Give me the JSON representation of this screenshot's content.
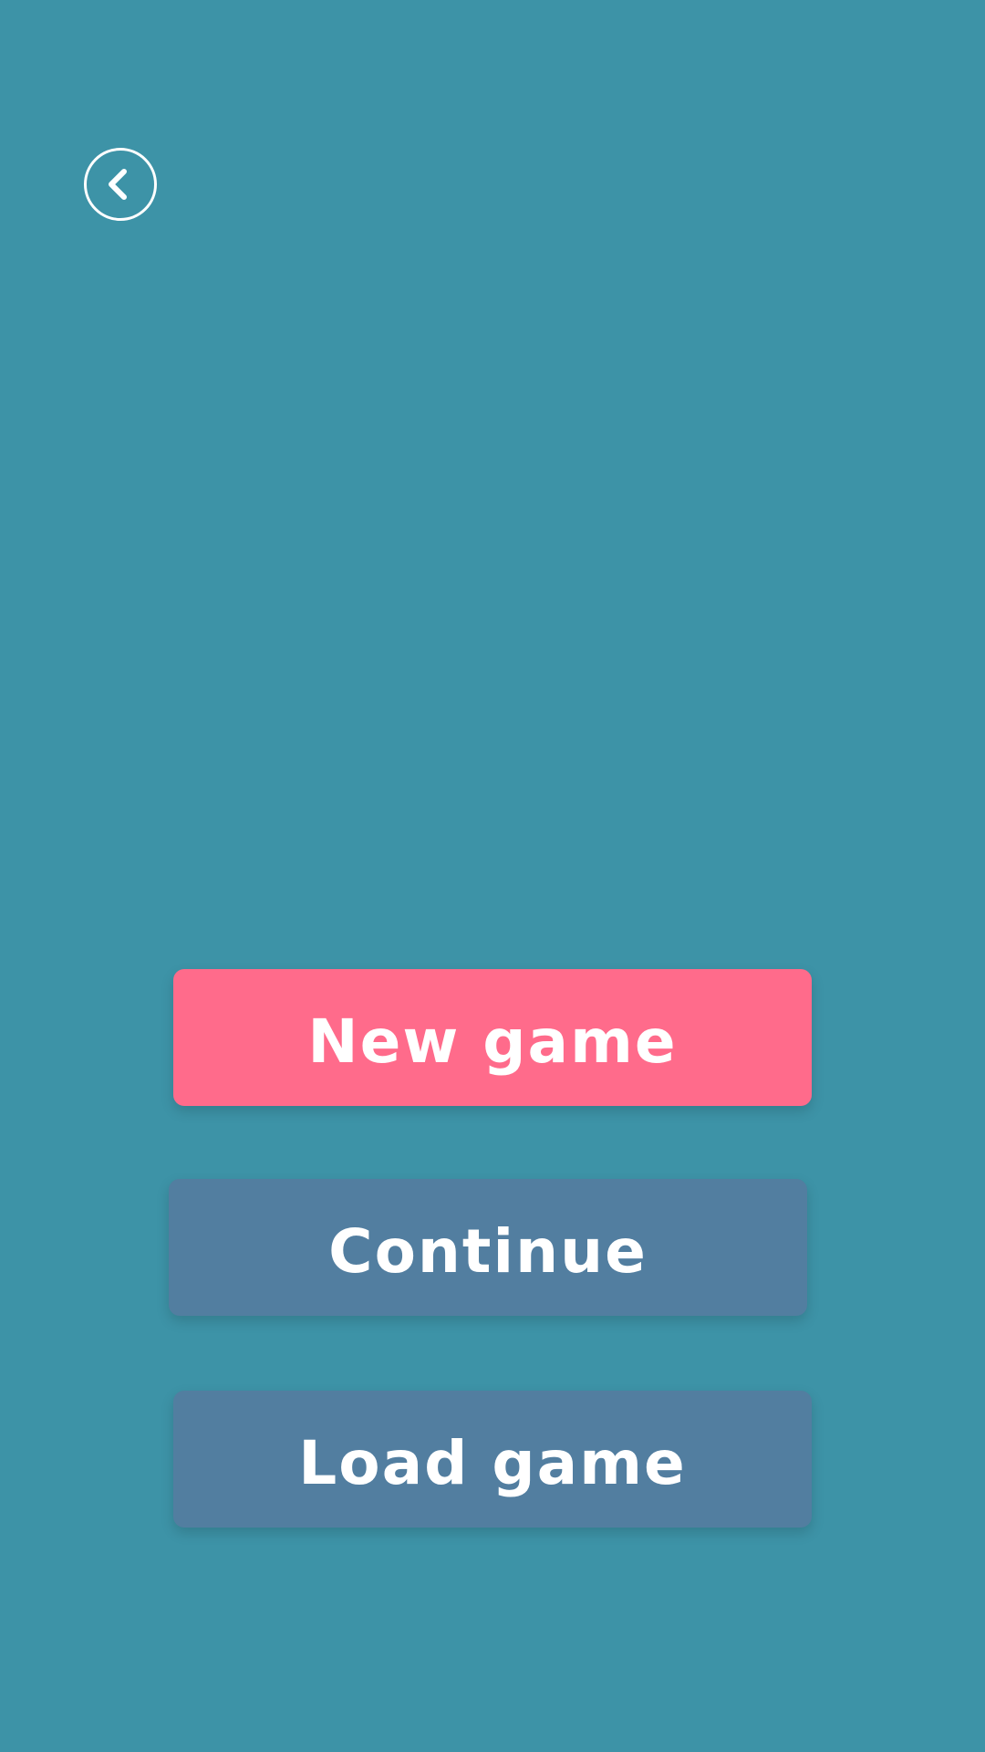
{
  "colors": {
    "background": "#3d93a7",
    "primary_button": "#ff6b8b",
    "secondary_button": "#527ea0",
    "text": "#ffffff"
  },
  "header": {
    "back_icon": "chevron-left-in-circle-icon"
  },
  "menu": {
    "new_game_label": "New game",
    "continue_label": "Continue",
    "load_game_label": "Load game"
  }
}
